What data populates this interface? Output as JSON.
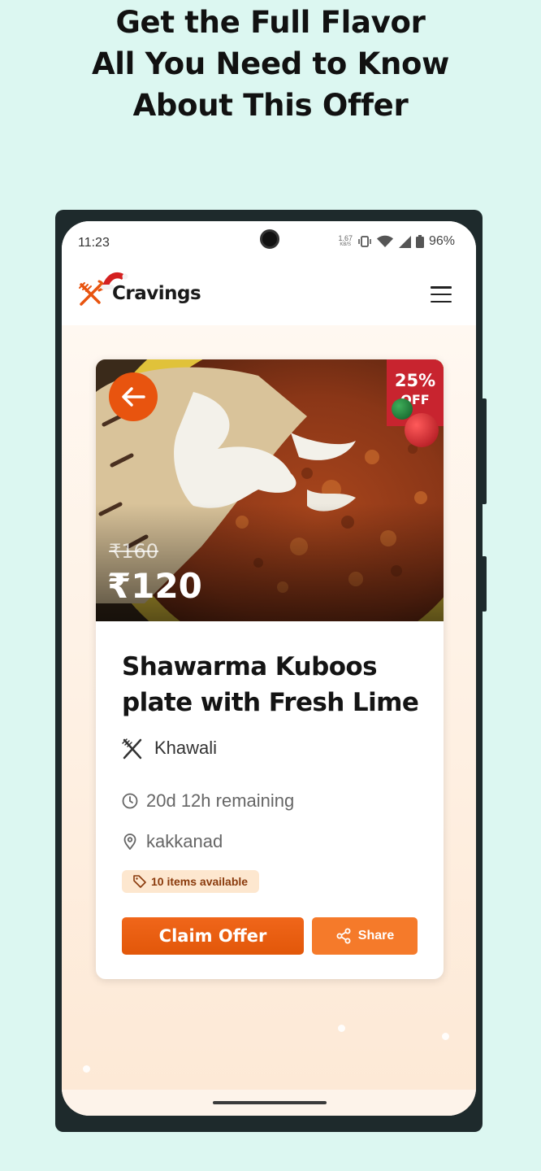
{
  "headline": {
    "line1": "Get the Full Flavor",
    "line2": "All You Need to Know",
    "line3": "About This Offer"
  },
  "status_bar": {
    "time": "11:23",
    "network_speed": "1.67",
    "network_unit": "KB/S",
    "battery": "96%"
  },
  "app": {
    "brand": "Cravings",
    "icons": {
      "logo": "fork-knife-icon",
      "hat": "santa-hat-icon",
      "menu": "hamburger-menu-icon"
    }
  },
  "offer": {
    "discount_pct": "25%",
    "discount_label": "OFF",
    "original_price": "₹160",
    "price": "₹120",
    "title": "Shawarma Kuboos plate with Fresh Lime",
    "restaurant": "Khawali",
    "time_remaining": "20d 12h remaining",
    "location": "kakkanad",
    "availability": "10 items available",
    "claim_label": "Claim Offer",
    "share_label": "Share"
  },
  "colors": {
    "accent": "#e8540f",
    "discount_badge": "#c8242f",
    "background": "#dcf7f1",
    "screen": "#fdf3ea"
  }
}
